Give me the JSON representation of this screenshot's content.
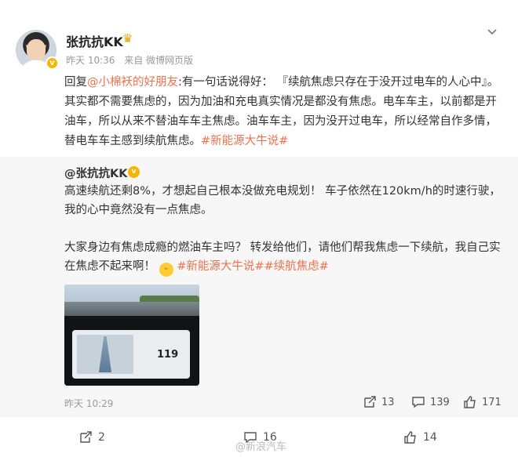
{
  "author": {
    "name": "张抗抗KK",
    "time": "昨天 10:36",
    "source": "来自 微博网页版"
  },
  "reply": {
    "prefix": "回复",
    "mention": "@小棉袄的好朋友",
    "body": ":有一句话说得好： 『续航焦虑只存在于没开过电车的人心中』。其实都不需要焦虑的，因为加油和充电真实情况是都没有焦虑。电车车主，以前都是开油车，所以从来不替油车车主焦虑。油车车主，因为没开过电车，所以经常自作多情，替电车车主感到续航焦虑。",
    "hashtag": "#新能源大牛说#"
  },
  "quoted": {
    "user": "@张抗抗KK",
    "paragraph1": "高速续航还剩8%，才想起自己根本没做充电规划！ 车子依然在120km/h的时速行驶，我的心中竟然没有一点焦虑。",
    "paragraph2_text": "大家身边有焦虑成瘾的燃油车主吗？ 转发给他们，请他们帮我焦虑一下续航，我自己实在焦虑不起来啊！",
    "hashtag1": "#新能源大牛说#",
    "hashtag2": "#续航焦虑#",
    "photo_speed": "119",
    "time": "昨天 10:29",
    "repost_count": "13",
    "comment_count": "139",
    "like_count": "171"
  },
  "footer": {
    "repost_count": "2",
    "comment_count": "16",
    "like_count": "14",
    "watermark": "@新浪汽车"
  },
  "colors": {
    "link": "#eb7350",
    "verified": "#f7b500",
    "quote_bg": "#f7f7f7"
  }
}
